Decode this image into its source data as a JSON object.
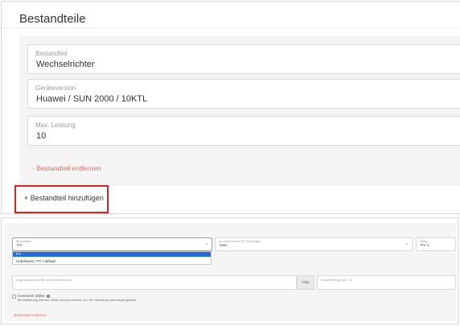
{
  "top_panel": {
    "title": "Bestandteile",
    "fields": [
      {
        "label": "Bestandteil",
        "value": "Wechselrichter"
      },
      {
        "label": "Geräteversion",
        "value": "Huawei / SUN 2000 / 10KTL"
      },
      {
        "label": "Max. Leistung",
        "value": "10"
      }
    ],
    "remove_label": "- Bestandteil entfernen",
    "add_label": "+ Bestandteil hinzufügen",
    "highlight_color": "#e0201f"
  },
  "bottom_panel": {
    "component": {
      "label": "Bestandteil",
      "value": "PV"
    },
    "dropdown_options": [
      "PV",
      "Unbekannt / PV / default"
    ],
    "existing_pv": {
      "label": "Zu bestehender PV hinzufügen",
      "value": "Nein"
    },
    "name": {
      "label": "Name",
      "value": "PV 1"
    },
    "power_field": {
      "placeholder": "Angeschlossene kWp am Wechselrichter",
      "unit": "kWp"
    },
    "strings_field": {
      "placeholder": "Anzahl Strings (min. 1)"
    },
    "inverted_meter": {
      "label": "Invertierter Zähler",
      "info_icon": "i",
      "help": "Bei Aktivierung wird der Zähler virtuell invertiert, d.h. der Stromfluss wird virtuell gedreht."
    },
    "remove_label": "- Bestandteil entfernen",
    "selected_color": "#1e6fd9"
  }
}
